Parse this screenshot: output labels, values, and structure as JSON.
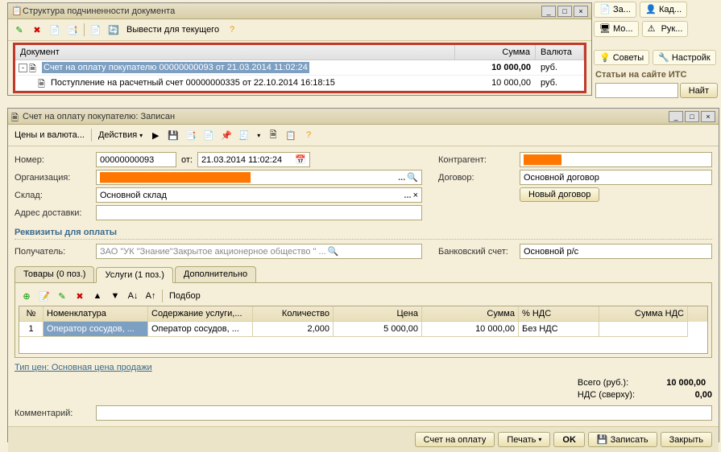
{
  "side": {
    "btns": [
      "За...",
      "Кад...",
      "Мо...",
      "Рук..."
    ],
    "tips": [
      "Советы",
      "Настройк"
    ],
    "panel_title": "Статьи на сайте ИТС",
    "find_btn": "Найт"
  },
  "win1": {
    "title": "Структура подчиненности документа",
    "toolbar": {
      "vyvesti": "Вывести для текущего"
    },
    "headers": {
      "doc": "Документ",
      "sum": "Сумма",
      "cur": "Валюта"
    },
    "rows": [
      {
        "indent": 0,
        "exp": "-",
        "text": "Счет на оплату покупателю 00000000093 от 21.03.2014 11:02:24",
        "sum": "10 000,00",
        "cur": "руб.",
        "sel": true
      },
      {
        "indent": 1,
        "exp": "",
        "text": "Поступление на расчетный счет 00000000335 от 22.10.2014 16:18:15",
        "sum": "10 000,00",
        "cur": "руб.",
        "sel": false
      }
    ]
  },
  "win2": {
    "title": "Счет на оплату покупателю: Записан",
    "toolbar": {
      "ceny": "Цены и валюта...",
      "deist": "Действия"
    },
    "fields": {
      "nomer_lbl": "Номер:",
      "nomer": "00000000093",
      "ot_lbl": "от:",
      "ot": "21.03.2014 11:02:24",
      "org_lbl": "Организация:",
      "org": "████████████████████████",
      "sklad_lbl": "Склад:",
      "sklad": "Основной склад",
      "adres_lbl": "Адрес доставки:",
      "adres": "",
      "kontr_lbl": "Контрагент:",
      "kontr": "██████",
      "dog_lbl": "Договор:",
      "dog": "Основной договор",
      "nov_dog_btn": "Новый договор"
    },
    "rekvizity_hdr": "Реквизиты для оплаты",
    "poluch_lbl": "Получатель:",
    "poluch": "ЗАО \"УК \"Знание\"Закрытое акционерное общество \" ...",
    "bank_lbl": "Банковский счет:",
    "bank": "Основной р/с",
    "tabs": {
      "tovary": "Товары (0 поз.)",
      "uslugi": "Услуги (1 поз.)",
      "dop": "Дополнительно"
    },
    "podbor": "Подбор",
    "grid_headers": {
      "n": "№",
      "nom": "Номенклатура",
      "sod": "Содержание услуги,...",
      "kol": "Количество",
      "cena": "Цена",
      "sum": "Сумма",
      "nds": "% НДС",
      "snds": "Сумма НДС"
    },
    "grid_row": {
      "n": "1",
      "nom": "Оператор сосудов, ...",
      "sod": "Оператор сосудов, ...",
      "kol": "2,000",
      "cena": "5 000,00",
      "sum": "10 000,00",
      "nds": "Без НДС",
      "snds": ""
    },
    "tip_cen": "Тип цен: Основная цена продажи",
    "totals": {
      "vsego_lbl": "Всего (руб.):",
      "vsego": "10 000,00",
      "nds_lbl": "НДС (сверху):",
      "nds": "0,00"
    },
    "komm_lbl": "Комментарий:",
    "komm": "",
    "buttons": {
      "schet": "Счет на оплату",
      "pechat": "Печать",
      "ok": "OK",
      "zapisat": "Записать",
      "zakryt": "Закрыть"
    }
  }
}
